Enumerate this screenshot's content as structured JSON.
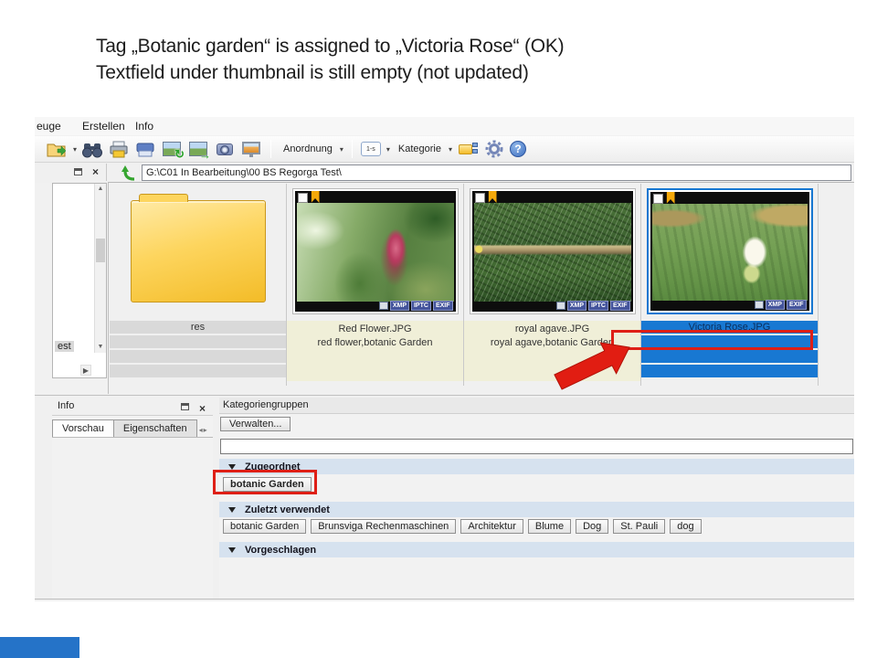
{
  "annotation": {
    "line1": "Tag „Botanic garden“ is assigned to „Victoria Rose“ (OK)",
    "line2": "Textfield under thumbnail is still empty (not updated)"
  },
  "menu": {
    "items": [
      "euge",
      "Erstellen",
      "Info"
    ]
  },
  "toolbar": {
    "anordnung": "Anordnung",
    "kategorie": "Kategorie",
    "sort_badge": "1-s"
  },
  "address": {
    "path": "G:\\C01 In Bearbeitung\\00 BS Regorga Test\\"
  },
  "tree": {
    "visible_item": "est"
  },
  "thumbnails": {
    "items": [
      {
        "name": "res"
      },
      {
        "name": "Red Flower.JPG",
        "tags": "red flower,botanic Garden"
      },
      {
        "name": "royal agave.JPG",
        "tags": "royal agave,botanic Garden"
      },
      {
        "name": "Victoria Rose.JPG",
        "tags": ""
      }
    ],
    "badges": {
      "xmp": "XMP",
      "iptc": "IPTC",
      "exif": "EXIF"
    }
  },
  "info_panel": {
    "title": "Info",
    "tab_vorschau": "Vorschau",
    "tab_eigenschaften": "Eigenschaften"
  },
  "category_panel": {
    "title": "Kategoriengruppen",
    "manage": "Verwalten...",
    "assigned_label": "Zugeordnet",
    "assigned_tags": [
      "botanic Garden"
    ],
    "recent_label": "Zuletzt verwendet",
    "recent_tags": [
      "botanic Garden",
      "Brunsviga Rechenmaschinen",
      "Architektur",
      "Blume",
      "Dog",
      "St. Pauli",
      "dog"
    ],
    "suggested_label": "Vorgeschlagen"
  },
  "colors": {
    "selection_blue": "#1878d2",
    "annotation_red": "#de1f16",
    "caption_yellow": "#f0efd8"
  }
}
